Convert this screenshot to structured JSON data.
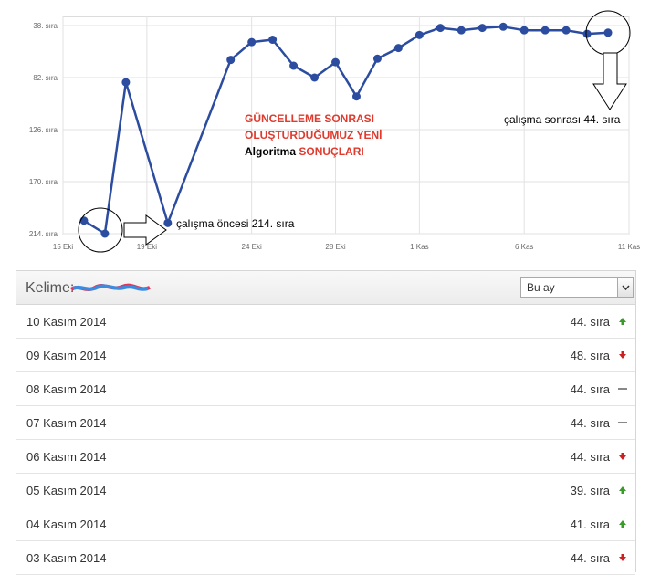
{
  "chart_data": {
    "type": "line",
    "x_labels": [
      "15 Eki",
      "19 Eki",
      "24 Eki",
      "28 Eki",
      "1 Kas",
      "6 Kas",
      "11 Kas"
    ],
    "y_labels": [
      "38. sıra",
      "82. sıra",
      "126. sıra",
      "170. sıra",
      "214. sıra"
    ],
    "y_ticks": [
      38,
      82,
      126,
      170,
      214
    ],
    "ylim": [
      38,
      214
    ],
    "y_inverted": true,
    "grid": true,
    "series": [
      {
        "color": "#2b4c9f",
        "x": [
          "16 Eki",
          "17 Eki",
          "18 Eki",
          "20 Eki",
          "23 Eki",
          "24 Eki",
          "25 Eki",
          "26 Eki",
          "27 Eki",
          "28 Eki",
          "29 Eki",
          "30 Eki",
          "31 Eki",
          "1 Kas",
          "2 Kas",
          "3 Kas",
          "4 Kas",
          "5 Kas",
          "6 Kas",
          "7 Kas",
          "8 Kas",
          "9 Kas",
          "10 Kas"
        ],
        "values": [
          203,
          214,
          86,
          205,
          67,
          52,
          50,
          72,
          82,
          69,
          98,
          66,
          57,
          46,
          40,
          42,
          40,
          39,
          42,
          42,
          42,
          45,
          44
        ]
      }
    ],
    "annotations": {
      "line1": "GÜNCELLEME SONRASI",
      "line2": "OLUŞTURDUĞUMUZ YENİ",
      "line3_a": "Algoritma",
      "line3_b": "SONUÇLARI",
      "after": "çalışma sonrası 44. sıra",
      "before": "çalışma öncesi 214. sıra"
    }
  },
  "panel": {
    "label": "Kelime:",
    "select_value": "Bu ay",
    "rows": [
      {
        "date": "10 Kasım 2014",
        "rank": "44. sıra",
        "trend": "up"
      },
      {
        "date": "09 Kasım 2014",
        "rank": "48. sıra",
        "trend": "down"
      },
      {
        "date": "08 Kasım 2014",
        "rank": "44. sıra",
        "trend": "same"
      },
      {
        "date": "07 Kasım 2014",
        "rank": "44. sıra",
        "trend": "same"
      },
      {
        "date": "06 Kasım 2014",
        "rank": "44. sıra",
        "trend": "down"
      },
      {
        "date": "05 Kasım 2014",
        "rank": "39. sıra",
        "trend": "up"
      },
      {
        "date": "04 Kasım 2014",
        "rank": "41. sıra",
        "trend": "up"
      },
      {
        "date": "03 Kasım 2014",
        "rank": "44. sıra",
        "trend": "down"
      }
    ]
  },
  "colors": {
    "line": "#2b4c9f",
    "up": "#3a9a2a",
    "down": "#cc2020",
    "same": "#888888"
  }
}
